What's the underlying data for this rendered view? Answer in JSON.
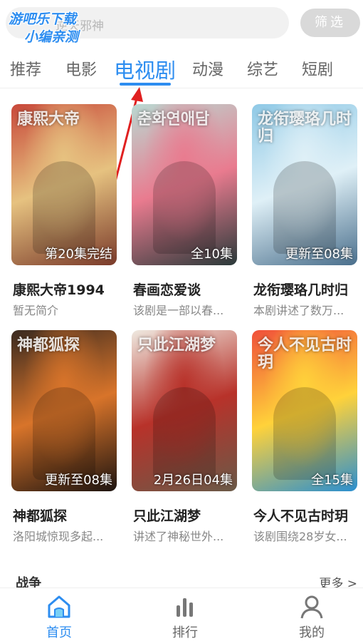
{
  "search": {
    "placeholder": "逆天邪神",
    "filter_label": "筛选"
  },
  "watermark": {
    "line1": "游吧乐下载",
    "line2": "小编亲测"
  },
  "tabs": [
    {
      "label": "推荐",
      "active": false
    },
    {
      "label": "电影",
      "active": false
    },
    {
      "label": "电视剧",
      "active": true
    },
    {
      "label": "动漫",
      "active": false
    },
    {
      "label": "综艺",
      "active": false
    },
    {
      "label": "短剧",
      "active": false
    }
  ],
  "cards": [
    {
      "title": "康熙大帝1994",
      "desc": "暂无简介",
      "badge": "第20集完结",
      "poster_text": "康熙大帝",
      "colors": [
        "#c8483a",
        "#e6c280",
        "#7a3a2a"
      ]
    },
    {
      "title": "春画恋爱谈",
      "desc": "该剧是一部以春...",
      "badge": "全10集",
      "poster_text": "춘화연애담",
      "colors": [
        "#b9d9d2",
        "#e97b8f",
        "#2b3a3a"
      ]
    },
    {
      "title": "龙衔璎珞几时归",
      "desc": "本剧讲述了数万...",
      "badge": "更新至08集",
      "poster_text": "龙衔璎珞几时归",
      "colors": [
        "#8fc9e6",
        "#dff0f7",
        "#4a6f8c"
      ]
    },
    {
      "title": "神都狐探",
      "desc": "洛阳城惊现多起...",
      "badge": "更新至08集",
      "poster_text": "神都狐探",
      "colors": [
        "#3a2a20",
        "#d8742a",
        "#1d1410"
      ]
    },
    {
      "title": "只此江湖梦",
      "desc": "讲述了神秘世外...",
      "badge": "2月26日04集",
      "poster_text": "只此江湖梦",
      "colors": [
        "#efe9e0",
        "#b8322a",
        "#6a5a48"
      ]
    },
    {
      "title": "今人不见古时玥",
      "desc": "该剧围绕28岁女...",
      "badge": "全15集",
      "poster_text": "今人不见古时玥",
      "colors": [
        "#f0503a",
        "#ffd23a",
        "#2a8fd0"
      ]
    }
  ],
  "section": {
    "title": "战争",
    "more": "更多 >"
  },
  "bottom_nav": [
    {
      "label": "首页",
      "icon": "home-icon",
      "active": true
    },
    {
      "label": "排行",
      "icon": "ranking-icon",
      "active": false
    },
    {
      "label": "我的",
      "icon": "profile-icon",
      "active": false
    }
  ],
  "colors": {
    "accent": "#2d8df0",
    "inactive_tab": "#666666",
    "filter_bg": "#d9d9d9"
  }
}
